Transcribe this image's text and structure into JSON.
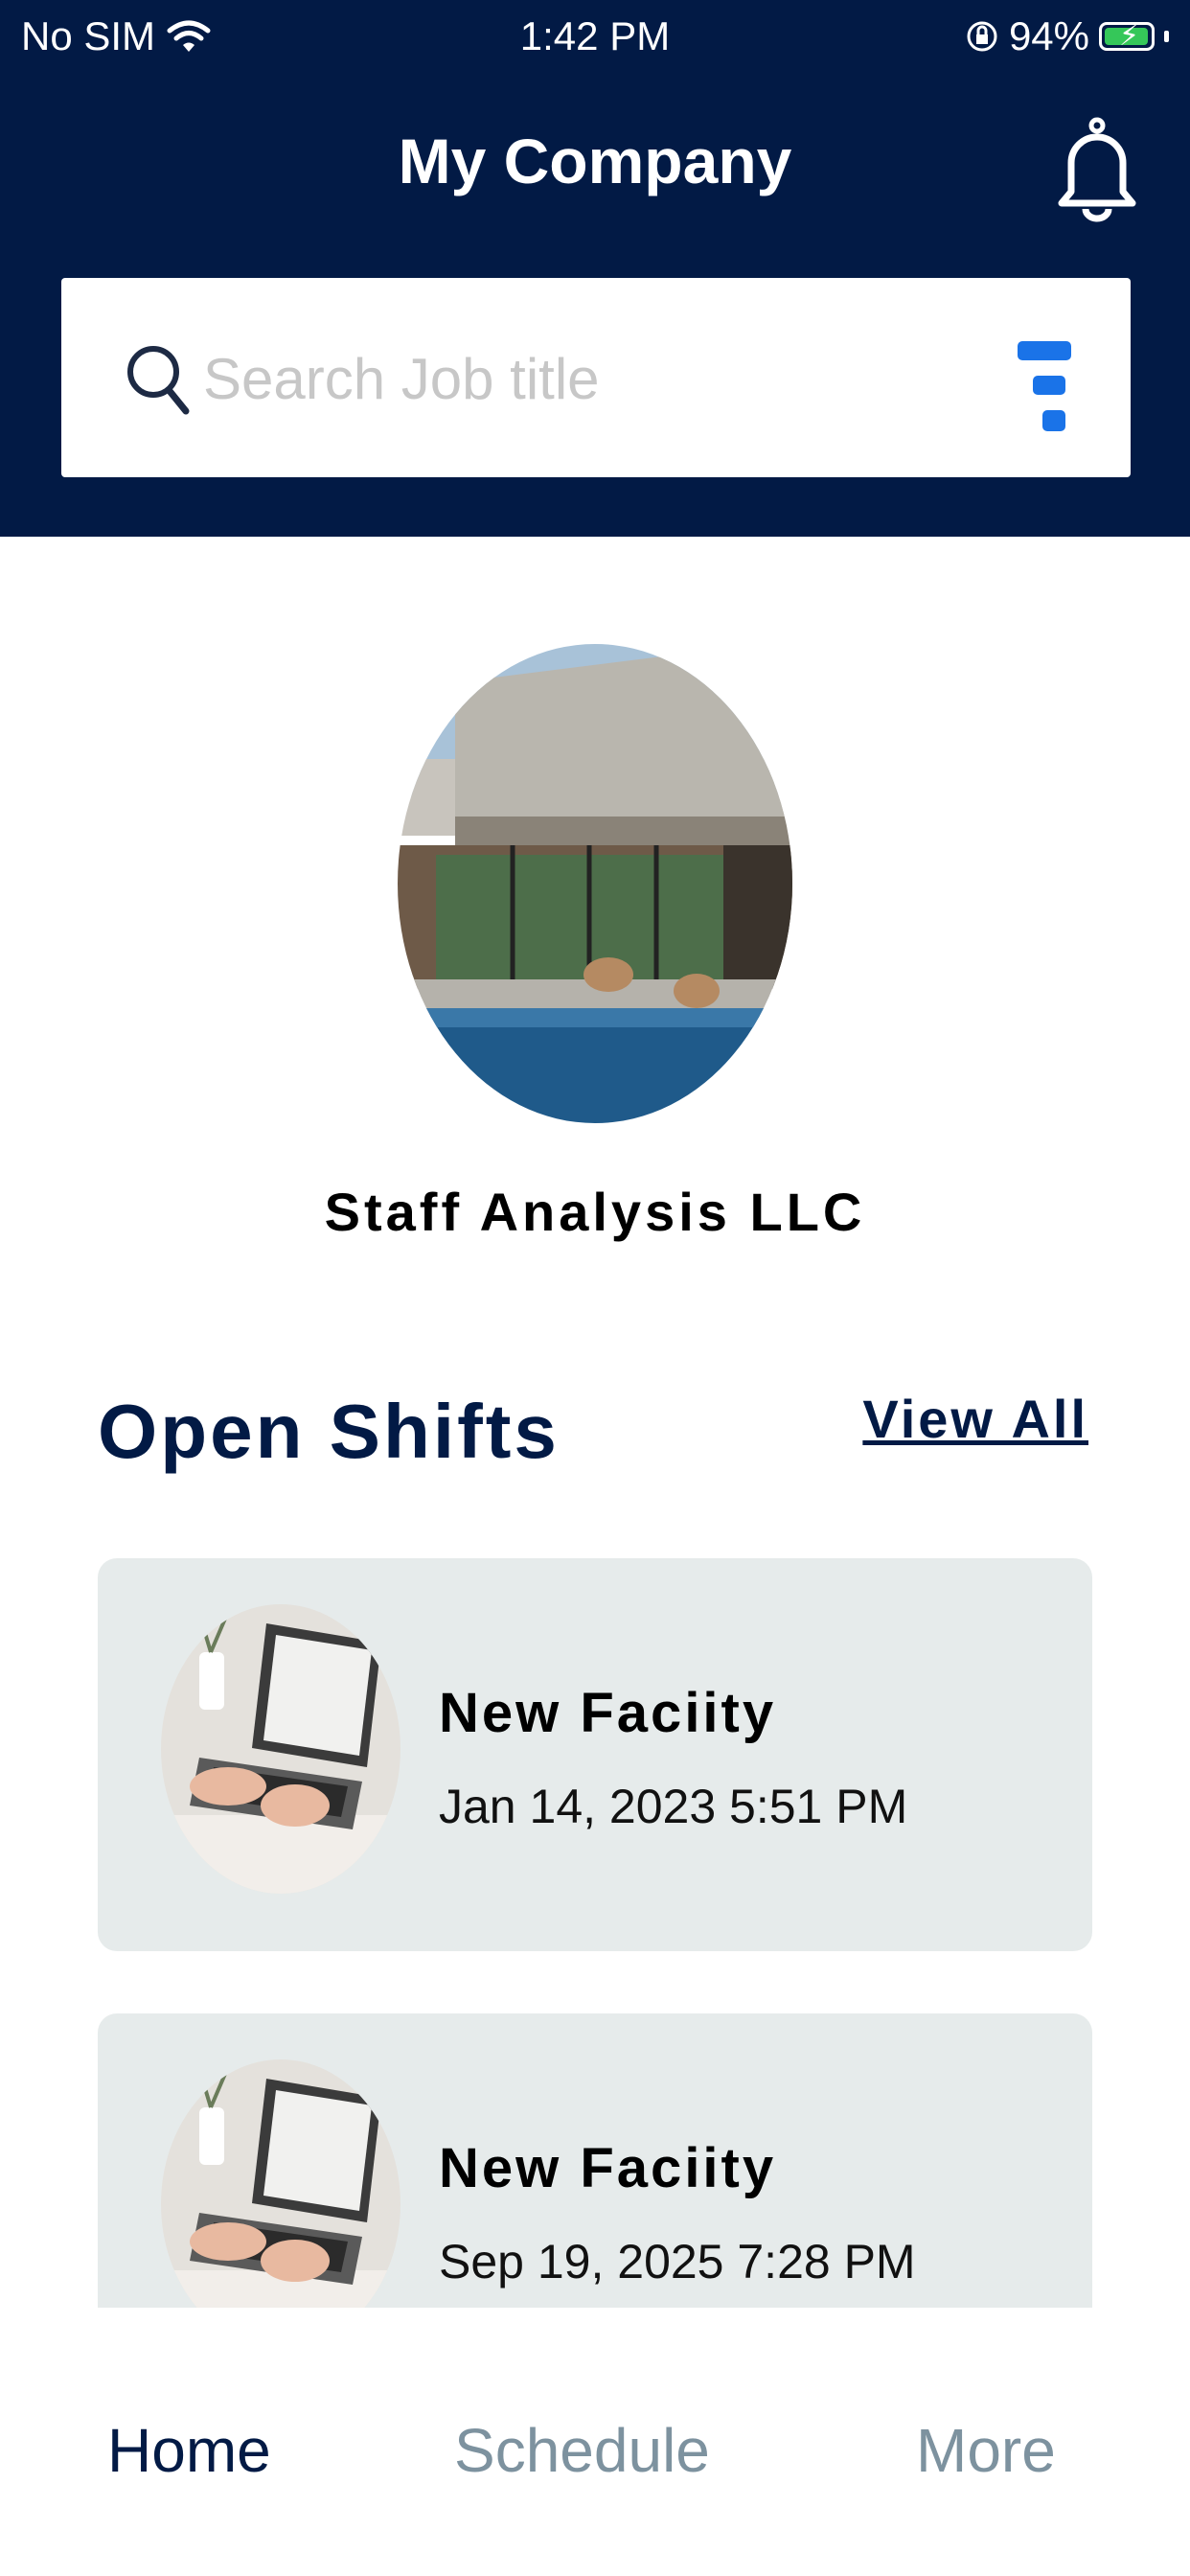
{
  "status_bar": {
    "carrier": "No SIM",
    "time": "1:42 PM",
    "battery_percent": "94%",
    "battery_level": 0.94,
    "icons": [
      "wifi-icon",
      "orientation-lock-icon",
      "battery-charging-icon"
    ]
  },
  "header": {
    "title": "My Company",
    "notification_icon": "bell-icon"
  },
  "search": {
    "placeholder": "Search Job title",
    "value": "",
    "search_icon": "search-icon",
    "filter_icon": "filter-icon"
  },
  "company": {
    "name": "Staff Analysis LLC"
  },
  "open_shifts": {
    "title": "Open Shifts",
    "view_all_label": "View All",
    "items": [
      {
        "title": "New Faciity",
        "date": "Jan 14, 2023 5:51 PM"
      },
      {
        "title": "New Faciity",
        "date": "Sep 19, 2025 7:28 PM"
      }
    ]
  },
  "tab_bar": {
    "tabs": [
      {
        "label": "Home",
        "active": true
      },
      {
        "label": "Schedule",
        "active": false
      },
      {
        "label": "More",
        "active": false
      }
    ]
  },
  "colors": {
    "header_bg": "#021a45",
    "accent_blue": "#1a73e8",
    "card_bg": "#e6ebeb",
    "tab_active": "#021a45",
    "tab_inactive": "#7d929f"
  }
}
